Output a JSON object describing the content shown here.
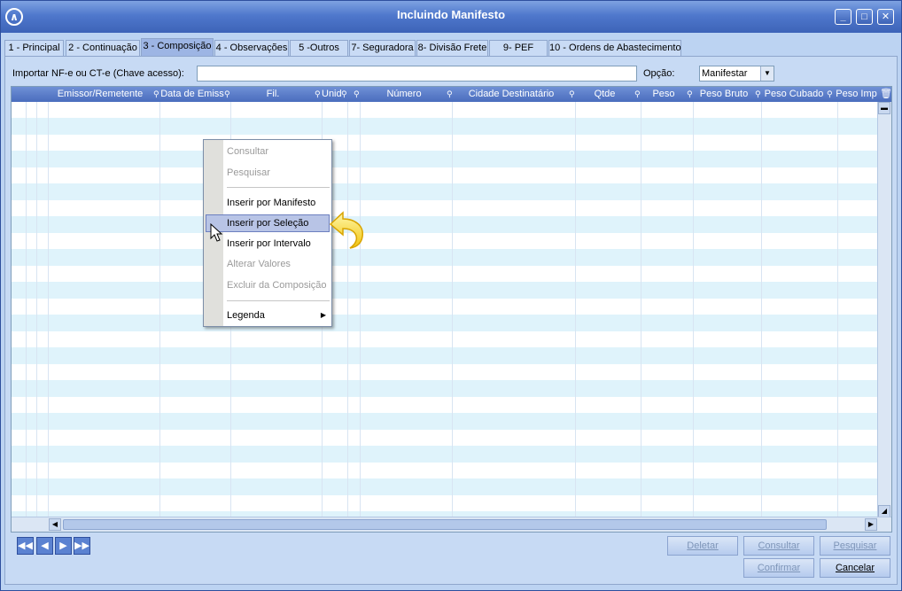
{
  "window": {
    "title": "Incluindo Manifesto"
  },
  "colors": {
    "titlebar": "#4f78cc",
    "header": "#5a7dc8",
    "row_alt": "#dff3fb",
    "highlight": "#b8c4e6"
  },
  "tabs": [
    {
      "label": "1 - Principal"
    },
    {
      "label": "2 - Continuação"
    },
    {
      "label": "3 - Composição",
      "active": true
    },
    {
      "label": "4 - Observações"
    },
    {
      "label": "5 -Outros"
    },
    {
      "label": "7- Seguradora"
    },
    {
      "label": "8- Divisão Frete"
    },
    {
      "label": "9- PEF"
    },
    {
      "label": "10 - Ordens de Abastecimento"
    }
  ],
  "import": {
    "label": "Importar NF-e ou CT-e  (Chave acesso):",
    "value": ""
  },
  "opcao": {
    "label": "Opção:",
    "value": "Manifestar"
  },
  "grid": {
    "columns": [
      {
        "label": "Emissor/Remetente"
      },
      {
        "label": "Data de Emiss"
      },
      {
        "label": "Fil."
      },
      {
        "label": "Unid"
      },
      {
        "label": ""
      },
      {
        "label": "Número"
      },
      {
        "label": "Cidade Destinatário"
      },
      {
        "label": "Qtde"
      },
      {
        "label": "Peso"
      },
      {
        "label": "Peso Bruto"
      },
      {
        "label": "Peso Cubado"
      },
      {
        "label": "Peso Imp"
      }
    ]
  },
  "context_menu": {
    "items": [
      {
        "label": "Consultar",
        "disabled": true
      },
      {
        "label": "Pesquisar",
        "disabled": true
      },
      {
        "label": "Inserir por Manifesto",
        "disabled": false
      },
      {
        "label": "Inserir por Seleção",
        "disabled": false,
        "hover": true
      },
      {
        "label": "Inserir por Intervalo",
        "disabled": false
      },
      {
        "label": "Alterar Valores",
        "disabled": true
      },
      {
        "label": "Excluir da Composição",
        "disabled": true
      },
      {
        "label": "Legenda",
        "disabled": false,
        "submenu": true
      }
    ]
  },
  "nav_buttons": {
    "first": "◀◀",
    "prev": "◀",
    "next": "▶",
    "last": "▶▶"
  },
  "buttons": {
    "deletar": "Deletar",
    "consultar": "Consultar",
    "pesquisar": "Pesquisar",
    "confirmar": "Confirmar",
    "cancelar": "Cancelar"
  }
}
